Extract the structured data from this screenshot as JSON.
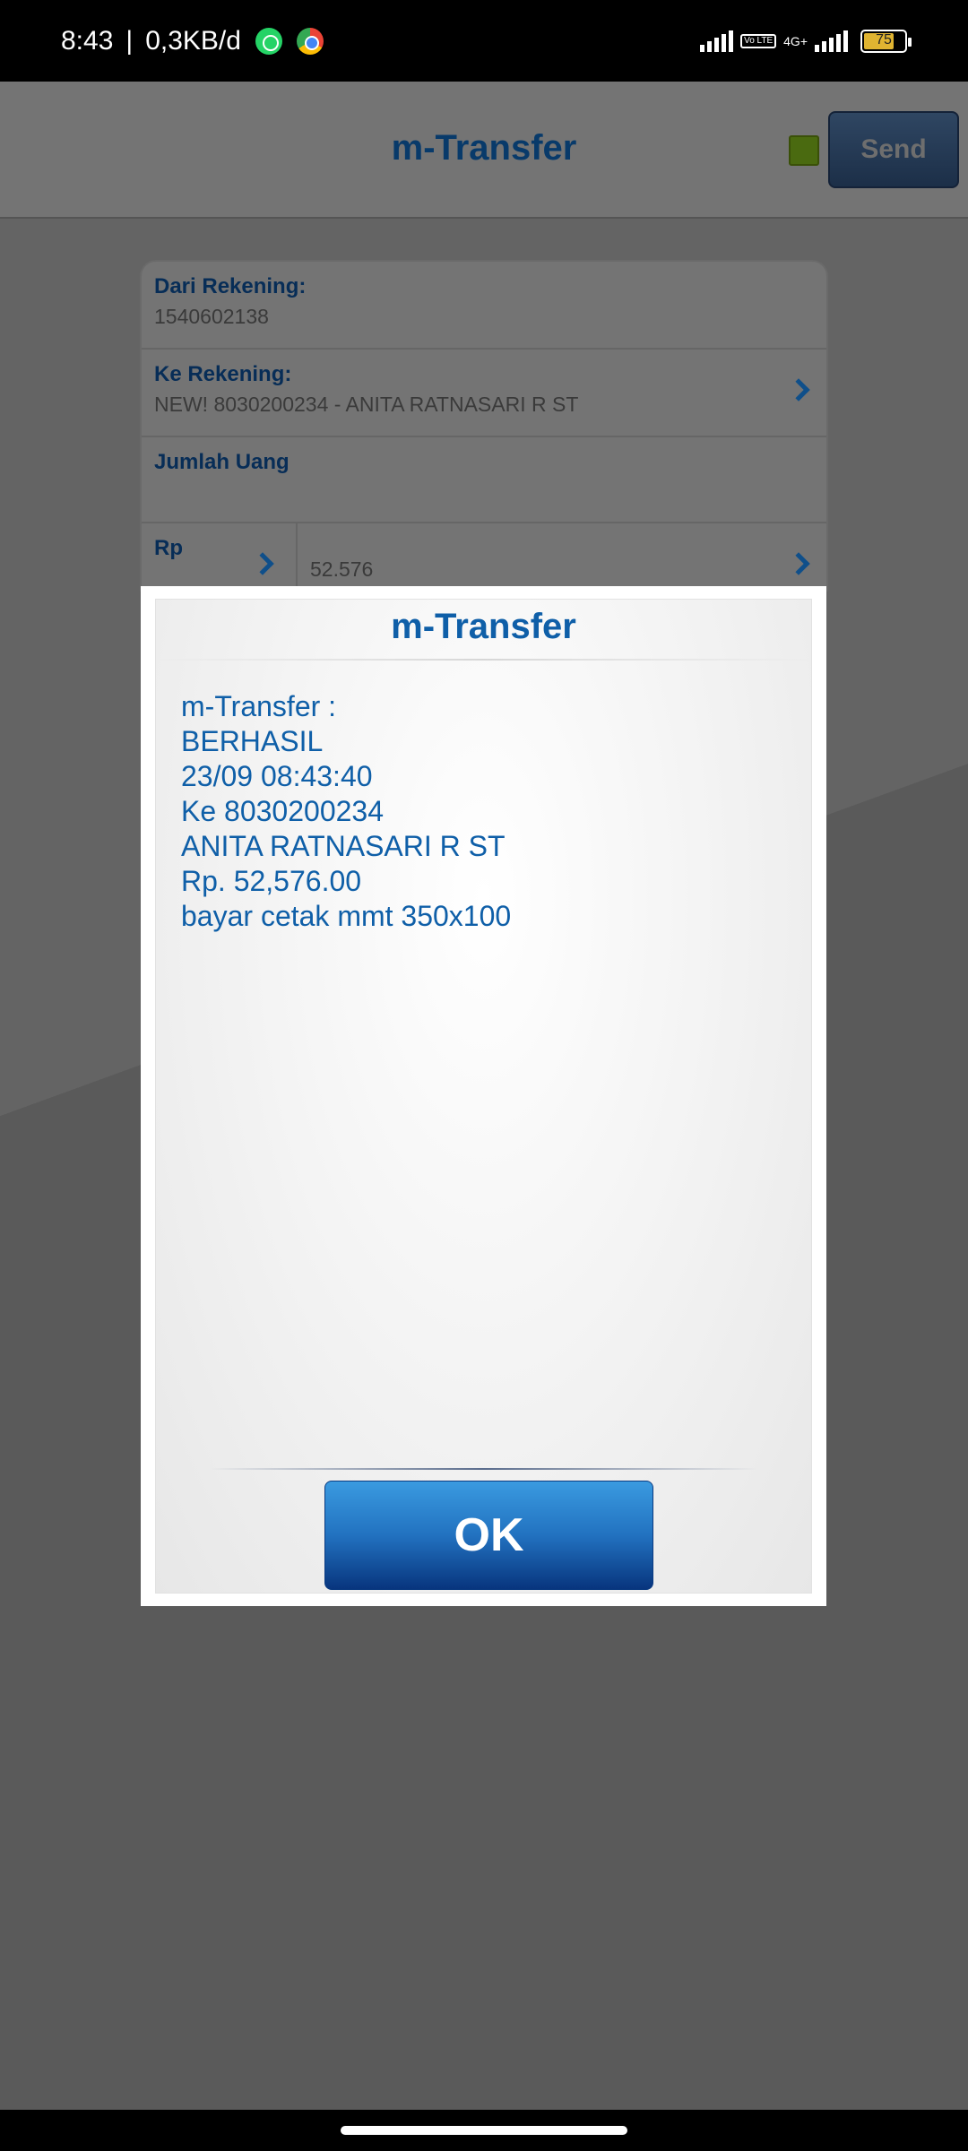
{
  "status_bar": {
    "time": "8:43",
    "separator": "|",
    "data_speed": "0,3KB/d",
    "volte": "Vo LTE",
    "network": "4G+",
    "battery": "75",
    "battery_level": 0.75,
    "battery_color": "#e0b431"
  },
  "header": {
    "title": "m-Transfer",
    "send_label": "Send",
    "indicator_color": "#4a6a10"
  },
  "form": {
    "from_label": "Dari Rekening:",
    "from_value": "1540602138",
    "to_label": "Ke Rekening:",
    "to_value": "NEW! 8030200234 - ANITA RATNASARI R ST",
    "amount_label": "Jumlah Uang",
    "currency_label": "Rp",
    "amount_value": "52.576"
  },
  "dialog": {
    "title": "m-Transfer",
    "lines": [
      "m-Transfer :",
      "BERHASIL",
      "23/09 08:43:40",
      "Ke 8030200234",
      "ANITA RATNASARI R ST",
      "Rp. 52,576.00",
      "bayar cetak mmt 350x100"
    ],
    "ok_label": "OK",
    "accent_color": "#0f5fa8"
  }
}
